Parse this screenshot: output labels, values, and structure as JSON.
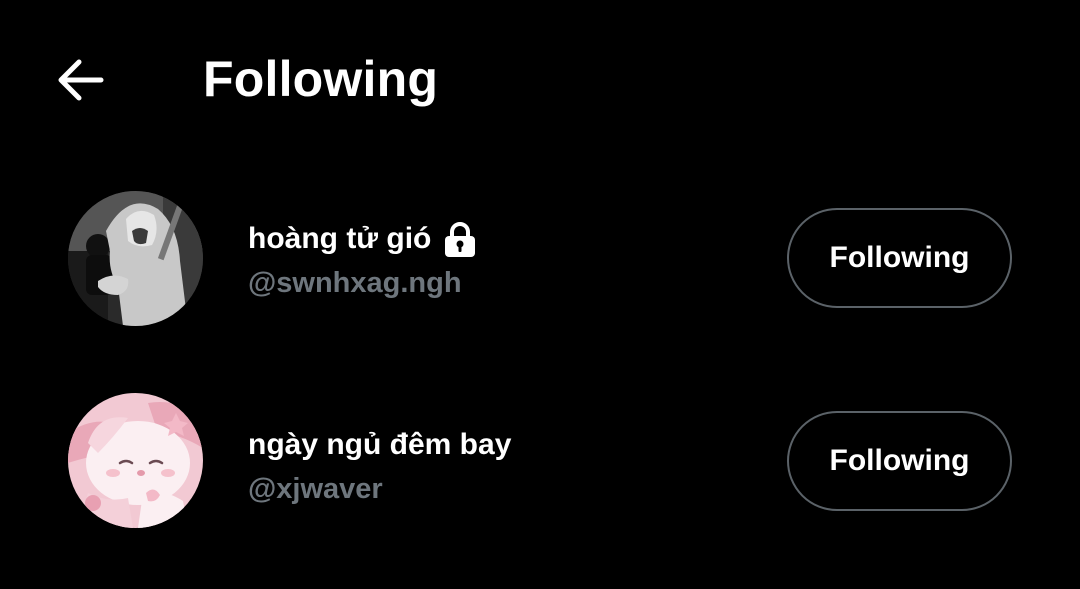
{
  "header": {
    "back_icon": "arrow-left-icon",
    "title": "Following"
  },
  "users": [
    {
      "display_name": "hoàng tử gió",
      "username": "@swnhxag.ngh",
      "locked": true,
      "lock_icon": "lock-icon",
      "avatar": "grayscale photo of person in hoodie",
      "button_label": "Following"
    },
    {
      "display_name": "ngày ngủ đêm bay",
      "username": "@xjwaver",
      "locked": false,
      "avatar": "pink cartoon character illustration",
      "button_label": "Following"
    }
  ],
  "colors": {
    "background": "#000000",
    "text_primary": "#ffffff",
    "text_secondary": "#6e767d",
    "button_border": "#5b6268"
  }
}
